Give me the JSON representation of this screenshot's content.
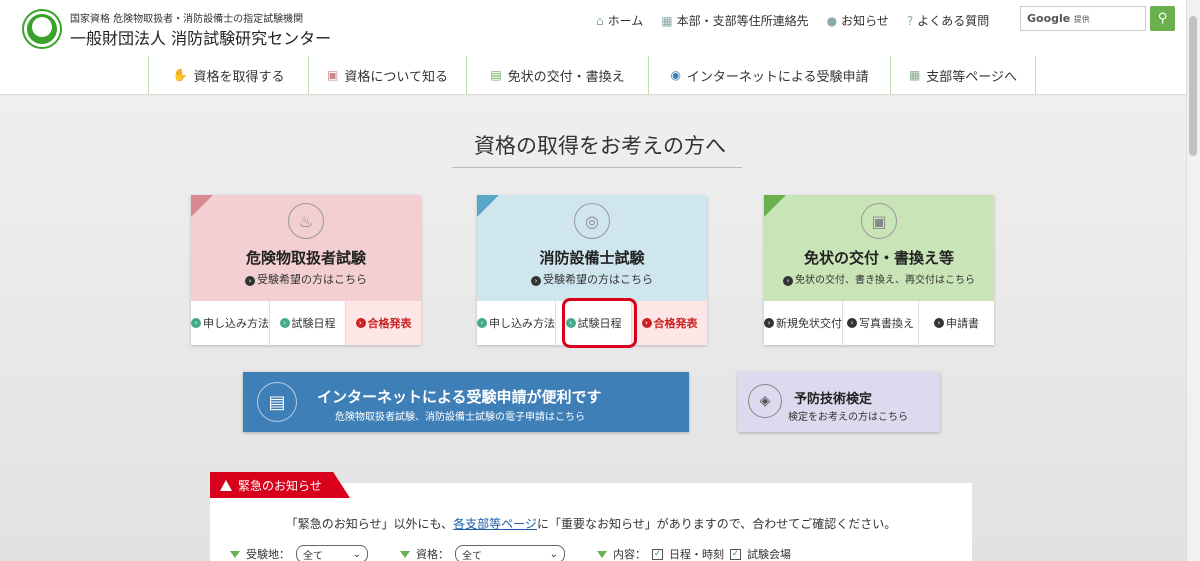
{
  "header": {
    "org_sub": "国家資格 危険物取扱者・消防設備士の指定試験機関",
    "org_name": "一般財団法人 消防試験研究センター",
    "topnav": [
      {
        "label": "ホーム",
        "icon": "home-icon"
      },
      {
        "label": "本部・支部等住所連絡先",
        "icon": "map-icon"
      },
      {
        "label": "お知らせ",
        "icon": "info-icon"
      },
      {
        "label": "よくある質問",
        "icon": "question-icon"
      }
    ],
    "search_brand": "Google",
    "search_suffix": "提供"
  },
  "mainnav": [
    {
      "label": "資格を取得する",
      "icon": "hand-icon"
    },
    {
      "label": "資格について知る",
      "icon": "people-icon"
    },
    {
      "label": "免状の交付・書換え",
      "icon": "card-icon"
    },
    {
      "label": "インターネットによる受験申請",
      "icon": "globe-icon"
    },
    {
      "label": "支部等ページへ",
      "icon": "map-icon"
    }
  ],
  "page_title": "資格の取得をお考えの方へ",
  "cards": [
    {
      "title": "危険物取扱者試験",
      "sub": "受験希望の方はこちら",
      "color": "#f3cfd1",
      "corner": "#d98a90",
      "links": [
        "申し込み方法",
        "試験日程",
        "合格発表"
      ]
    },
    {
      "title": "消防設備士試験",
      "sub": "受験希望の方はこちら",
      "color": "#cfe6ef",
      "corner": "#5aa6c8",
      "links": [
        "申し込み方法",
        "試験日程",
        "合格発表"
      ]
    },
    {
      "title": "免状の交付・書換え等",
      "sub": "免状の交付、書き換え、再交付はこちら",
      "color": "#c9e5b8",
      "corner": "#6ab04c",
      "links": [
        "新規免状交付",
        "写真書換え",
        "申請書"
      ]
    }
  ],
  "banner_net": {
    "title": "インターネットによる受験申請が便利です",
    "sub": "危険物取扱者試験、消防設備士試験の電子申請はこちら"
  },
  "banner_prev": {
    "title": "予防技術検定",
    "sub": "検定をお考えの方はこちら"
  },
  "notice": {
    "tab": "緊急のお知らせ",
    "text_before": "「緊急のお知らせ」以外にも、",
    "link": "各支部等ページ",
    "text_after": "に「重要なお知らせ」がありますので、合わせてご確認ください。"
  },
  "filters": {
    "area_label": "受験地：",
    "area_value": "全て",
    "cert_label": "資格：",
    "cert_value": "全て",
    "content_label": "内容：",
    "opt1": "日程・時刻",
    "opt2": "試験会場"
  }
}
